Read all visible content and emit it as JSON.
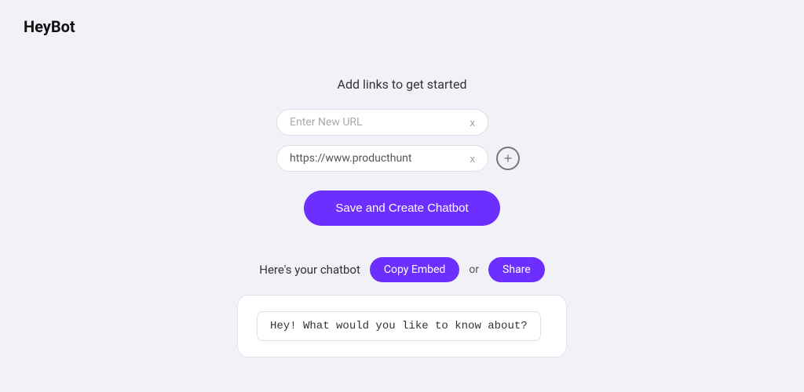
{
  "app": {
    "logo": "HeyBot"
  },
  "main": {
    "title": "Add links to get started",
    "url_input_1": {
      "placeholder": "Enter New URL",
      "value": "",
      "clear_label": "x"
    },
    "url_input_2": {
      "placeholder": "",
      "value": "https://www.producthunt",
      "clear_label": "x",
      "add_label": "+"
    },
    "save_button_label": "Save and Create Chatbot"
  },
  "chatbot_section": {
    "label": "Here's your chatbot",
    "copy_embed_label": "Copy Embed",
    "or_text": "or",
    "share_label": "Share",
    "chat_message": "Hey! What would you like to know about?"
  }
}
